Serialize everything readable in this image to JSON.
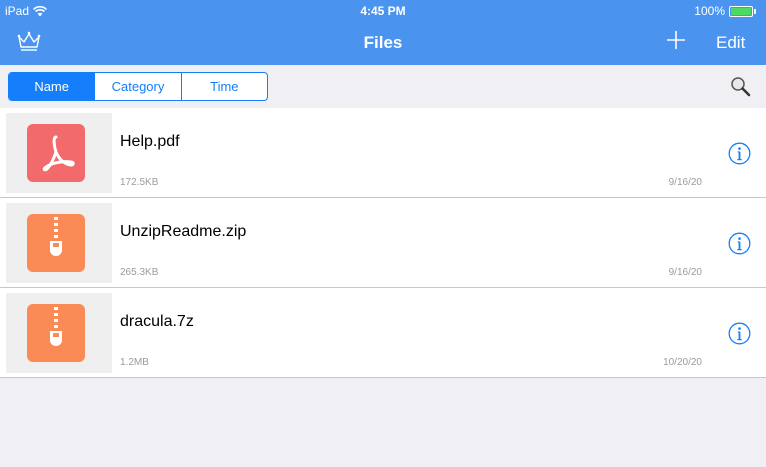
{
  "status": {
    "carrier": "iPad",
    "time": "4:45 PM",
    "battery": "100%"
  },
  "nav": {
    "title": "Files",
    "edit_label": "Edit",
    "left_icon": "crown-icon",
    "add_icon": "plus-icon"
  },
  "sort_tabs": [
    {
      "label": "Name",
      "active": true
    },
    {
      "label": "Category",
      "active": false
    },
    {
      "label": "Time",
      "active": false
    }
  ],
  "search_icon": "magnifier-icon",
  "files": [
    {
      "name": "Help.pdf",
      "size": "172.5KB",
      "date": "9/16/20",
      "type": "pdf"
    },
    {
      "name": "UnzipReadme.zip",
      "size": "265.3KB",
      "date": "9/16/20",
      "type": "zip"
    },
    {
      "name": "dracula.7z",
      "size": "1.2MB",
      "date": "10/20/20",
      "type": "zip"
    }
  ],
  "colors": {
    "header": "#4a94f0",
    "accent": "#157efb",
    "pdf": "#f36a6d",
    "zip": "#fa8b57",
    "background": "#efeff4"
  }
}
